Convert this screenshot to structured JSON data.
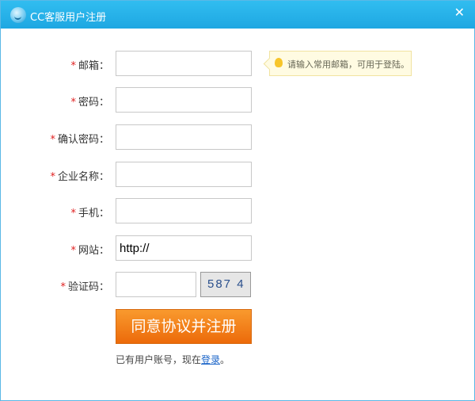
{
  "window": {
    "title": "CC客服用户注册",
    "close": "✕"
  },
  "form": {
    "fields": [
      {
        "label": "邮箱：",
        "required": true,
        "value": ""
      },
      {
        "label": "密码：",
        "required": true,
        "value": ""
      },
      {
        "label": "确认密码：",
        "required": true,
        "value": ""
      },
      {
        "label": "企业名称：",
        "required": true,
        "value": ""
      },
      {
        "label": "手机：",
        "required": true,
        "value": ""
      },
      {
        "label": "网站：",
        "required": true,
        "value": "http://"
      },
      {
        "label": "验证码：",
        "required": true,
        "value": ""
      }
    ],
    "required_mark": "*",
    "email_tip": "请输入常用邮箱，可用于登陆。",
    "captcha_text": "587 4",
    "submit": "同意协议并注册",
    "login_prefix": "已有用户账号，现在",
    "login_link": "登录",
    "login_suffix": "。"
  }
}
